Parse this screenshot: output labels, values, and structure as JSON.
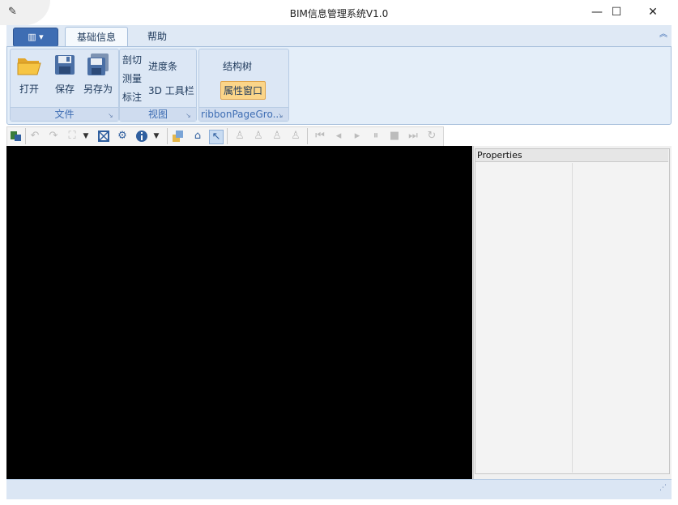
{
  "window": {
    "title": "BIM信息管理系统V1.0",
    "controls": {
      "minimize": "—",
      "maximize": "☐",
      "close": "✕"
    }
  },
  "ribbon": {
    "tabs": [
      {
        "label": "基础信息",
        "active": true
      },
      {
        "label": "帮助",
        "active": false
      }
    ],
    "groups": {
      "file": {
        "label": "文件",
        "buttons": [
          {
            "label": "打开",
            "icon": "folder-open-icon"
          },
          {
            "label": "保存",
            "icon": "save-icon"
          },
          {
            "label": "另存为",
            "icon": "save-as-icon"
          }
        ]
      },
      "view": {
        "label": "视图",
        "left_column": [
          "剖切",
          "测量",
          "标注"
        ],
        "right_column": [
          "进度条",
          "3D 工具栏"
        ]
      },
      "page_group": {
        "label": "ribbonPageGro...",
        "buttons": [
          {
            "label": "结构树",
            "checked": false
          },
          {
            "label": "属性窗口",
            "checked": true
          }
        ]
      }
    }
  },
  "properties_panel": {
    "header": "Properties"
  },
  "colors": {
    "ribbon_accent": "#3e6db3",
    "viewport_bg": "#000000",
    "checked_button_bg": "#fbd589"
  }
}
